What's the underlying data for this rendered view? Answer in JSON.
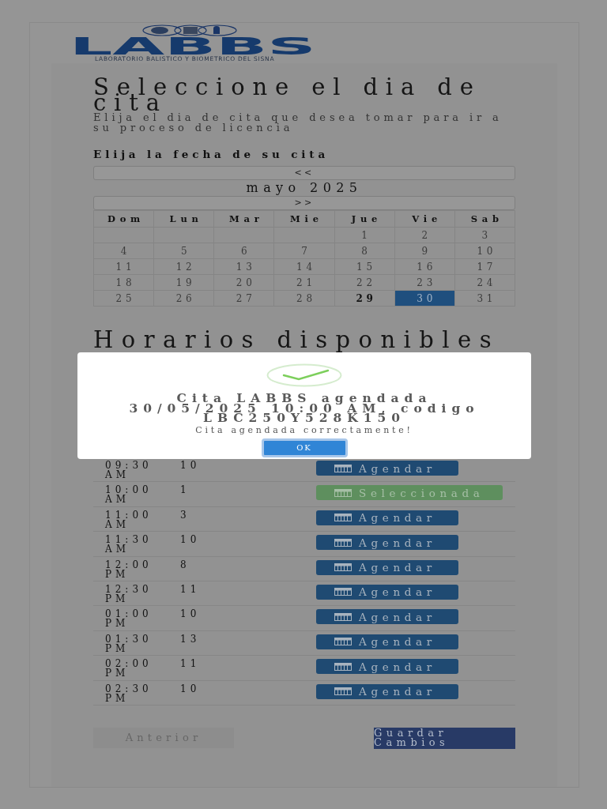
{
  "logo": {
    "wordmark": "LABBS",
    "tagline": "LABORATORIO BALISTICO Y BIOMETRICO DEL SISNA"
  },
  "page": {
    "title": "Seleccione el dia de cita",
    "subtitle": "Elija el dia de cita que desea tomar para ir a su proceso de licencia"
  },
  "calendar": {
    "label": "Elija la fecha de su cita",
    "prev_button": "<<",
    "month": "mayo 2025",
    "next_button": ">>",
    "weekdays": [
      "Dom",
      "Lun",
      "Mar",
      "Mie",
      "Jue",
      "Vie",
      "Sab"
    ],
    "weeks": [
      [
        {
          "kind": "blank"
        },
        {
          "kind": "blank"
        },
        {
          "kind": "blank"
        },
        {
          "kind": "blank"
        },
        {
          "kind": "day",
          "day": "1",
          "selected": false,
          "today": false
        },
        {
          "kind": "day",
          "day": "2",
          "selected": false,
          "today": false
        },
        {
          "kind": "day",
          "day": "3",
          "selected": false,
          "today": false
        }
      ],
      [
        {
          "kind": "day",
          "day": "4",
          "selected": false,
          "today": false
        },
        {
          "kind": "day",
          "day": "5",
          "selected": false,
          "today": false
        },
        {
          "kind": "day",
          "day": "6",
          "selected": false,
          "today": false
        },
        {
          "kind": "day",
          "day": "7",
          "selected": false,
          "today": false
        },
        {
          "kind": "day",
          "day": "8",
          "selected": false,
          "today": false
        },
        {
          "kind": "day",
          "day": "9",
          "selected": false,
          "today": false
        },
        {
          "kind": "day",
          "day": "10",
          "selected": false,
          "today": false
        }
      ],
      [
        {
          "kind": "day",
          "day": "11",
          "selected": false,
          "today": false
        },
        {
          "kind": "day",
          "day": "12",
          "selected": false,
          "today": false
        },
        {
          "kind": "day",
          "day": "13",
          "selected": false,
          "today": false
        },
        {
          "kind": "day",
          "day": "14",
          "selected": false,
          "today": false
        },
        {
          "kind": "day",
          "day": "15",
          "selected": false,
          "today": false
        },
        {
          "kind": "day",
          "day": "16",
          "selected": false,
          "today": false
        },
        {
          "kind": "day",
          "day": "17",
          "selected": false,
          "today": false
        }
      ],
      [
        {
          "kind": "day",
          "day": "18",
          "selected": false,
          "today": false
        },
        {
          "kind": "day",
          "day": "19",
          "selected": false,
          "today": false
        },
        {
          "kind": "day",
          "day": "20",
          "selected": false,
          "today": false
        },
        {
          "kind": "day",
          "day": "21",
          "selected": false,
          "today": false
        },
        {
          "kind": "day",
          "day": "22",
          "selected": false,
          "today": false
        },
        {
          "kind": "day",
          "day": "23",
          "selected": false,
          "today": false
        },
        {
          "kind": "day",
          "day": "24",
          "selected": false,
          "today": false
        }
      ],
      [
        {
          "kind": "day",
          "day": "25",
          "selected": false,
          "today": false
        },
        {
          "kind": "day",
          "day": "26",
          "selected": false,
          "today": false
        },
        {
          "kind": "day",
          "day": "27",
          "selected": false,
          "today": false
        },
        {
          "kind": "day",
          "day": "28",
          "selected": false,
          "today": false
        },
        {
          "kind": "day",
          "day": "29",
          "selected": false,
          "today": true
        },
        {
          "kind": "day",
          "day": "30",
          "selected": true,
          "today": false
        },
        {
          "kind": "day",
          "day": "31",
          "selected": false,
          "today": false
        }
      ]
    ]
  },
  "schedule": {
    "title": "Horarios disponibles",
    "rows": [
      {
        "time": "09:30 AM",
        "slots": "10",
        "button": "Agendar",
        "selected": false
      },
      {
        "time": "10:00 AM",
        "slots": "1",
        "button": "Seleccionada",
        "selected": true
      },
      {
        "time": "11:00 AM",
        "slots": "3",
        "button": "Agendar",
        "selected": false
      },
      {
        "time": "11:30 AM",
        "slots": "10",
        "button": "Agendar",
        "selected": false
      },
      {
        "time": "12:00 PM",
        "slots": "8",
        "button": "Agendar",
        "selected": false
      },
      {
        "time": "12:30 PM",
        "slots": "11",
        "button": "Agendar",
        "selected": false
      },
      {
        "time": "01:00 PM",
        "slots": "10",
        "button": "Agendar",
        "selected": false
      },
      {
        "time": "01:30 PM",
        "slots": "13",
        "button": "Agendar",
        "selected": false
      },
      {
        "time": "02:00 PM",
        "slots": "11",
        "button": "Agendar",
        "selected": false
      },
      {
        "time": "02:30 PM",
        "slots": "10",
        "button": "Agendar",
        "selected": false
      }
    ]
  },
  "dialog": {
    "title": "Cita LABBS agendada 30/05/2025 10:00 AM, codigo LBC250Y528K150",
    "message": "Cita agendada correctamente!",
    "button": "OK"
  },
  "footer": {
    "back_button": "Anterior",
    "save_button": "Guardar Cambios"
  }
}
